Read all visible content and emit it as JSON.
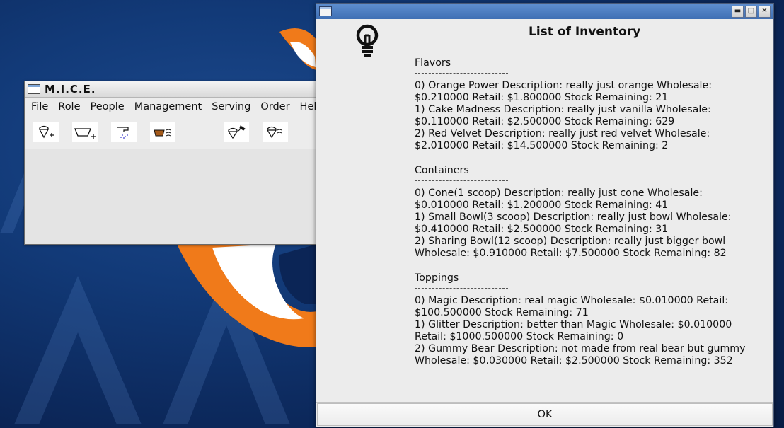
{
  "mice_window": {
    "title": "M.I.C.E.",
    "menus": [
      "File",
      "Role",
      "People",
      "Management",
      "Serving",
      "Order",
      "Hel"
    ],
    "toolbar_icons": [
      "add-flavor-icon",
      "add-container-icon",
      "add-topping-icon",
      "serve-icon",
      "order-icon",
      "order-topping-icon"
    ]
  },
  "dialog": {
    "heading": "List of Inventory",
    "sections": [
      {
        "title": "Flavors",
        "rule": "--------------------------------------",
        "items": [
          "0) Orange Power Description: really just orange Wholesale: $0.210000 Retail: $1.800000 Stock Remaining: 21",
          "1) Cake Madness Description: really just vanilla Wholesale: $0.110000 Retail: $2.500000 Stock Remaining: 629",
          "2) Red Velvet Description: really just red velvet Wholesale: $2.010000 Retail: $14.500000 Stock Remaining: 2"
        ]
      },
      {
        "title": "Containers",
        "rule": "--------------------------------------",
        "items": [
          "0) Cone(1 scoop) Description: really just cone Wholesale: $0.010000 Retail: $1.200000 Stock Remaining: 41",
          "1) Small Bowl(3 scoop) Description: really just bowl Wholesale: $0.410000 Retail: $2.500000 Stock Remaining: 31",
          "2) Sharing Bowl(12 scoop) Description: really just bigger bowl Wholesale: $0.910000 Retail: $7.500000 Stock Remaining: 82"
        ]
      },
      {
        "title": "Toppings",
        "rule": "--------------------------------------",
        "items": [
          "0) Magic Description: real magic Wholesale: $0.010000 Retail: $100.500000 Stock Remaining: 71",
          "1) Glitter Description: better than Magic Wholesale: $0.010000 Retail: $1000.500000 Stock Remaining: 0",
          "2) Gummy Bear Description: not made from real bear but gummy Wholesale: $0.030000 Retail: $2.500000 Stock Remaining: 352"
        ]
      }
    ],
    "ok_label": "OK",
    "window_buttons": [
      "minimize-icon",
      "maximize-icon",
      "close-icon"
    ]
  },
  "colors": {
    "desktop": "#123a78",
    "accent_orange": "#f07a1a",
    "dialog_title": "#4f7fc4"
  }
}
